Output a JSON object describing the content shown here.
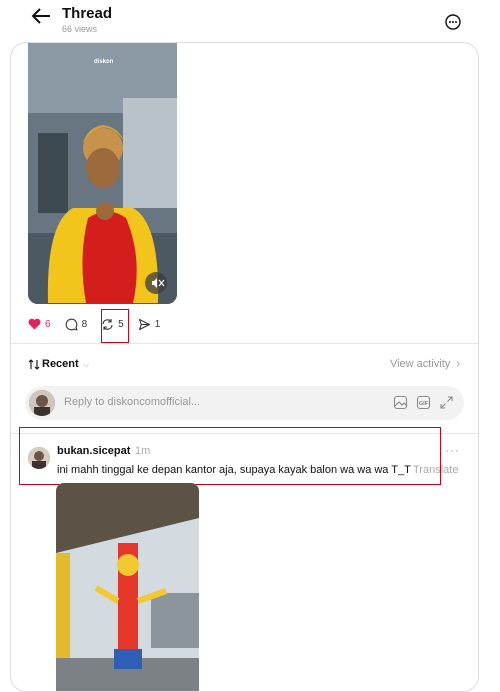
{
  "header": {
    "title": "Thread",
    "views": "66 views"
  },
  "post": {
    "video_watermark": "diskon",
    "likes": "6",
    "comments": "8",
    "reposts": "5",
    "shares": "1",
    "colors": {
      "like": "#e0245e",
      "highlight": "#d0021b"
    }
  },
  "sort": {
    "label": "Recent",
    "view_activity": "View activity"
  },
  "reply_box": {
    "placeholder": "Reply to diskoncomofficial..."
  },
  "comment": {
    "username": "bukan.sicepat",
    "time": "1m",
    "text": "ini mahh tinggal ke depan kantor aja, supaya kayak balon wa wa wa T_T",
    "translate": "Translate",
    "more": "···"
  }
}
